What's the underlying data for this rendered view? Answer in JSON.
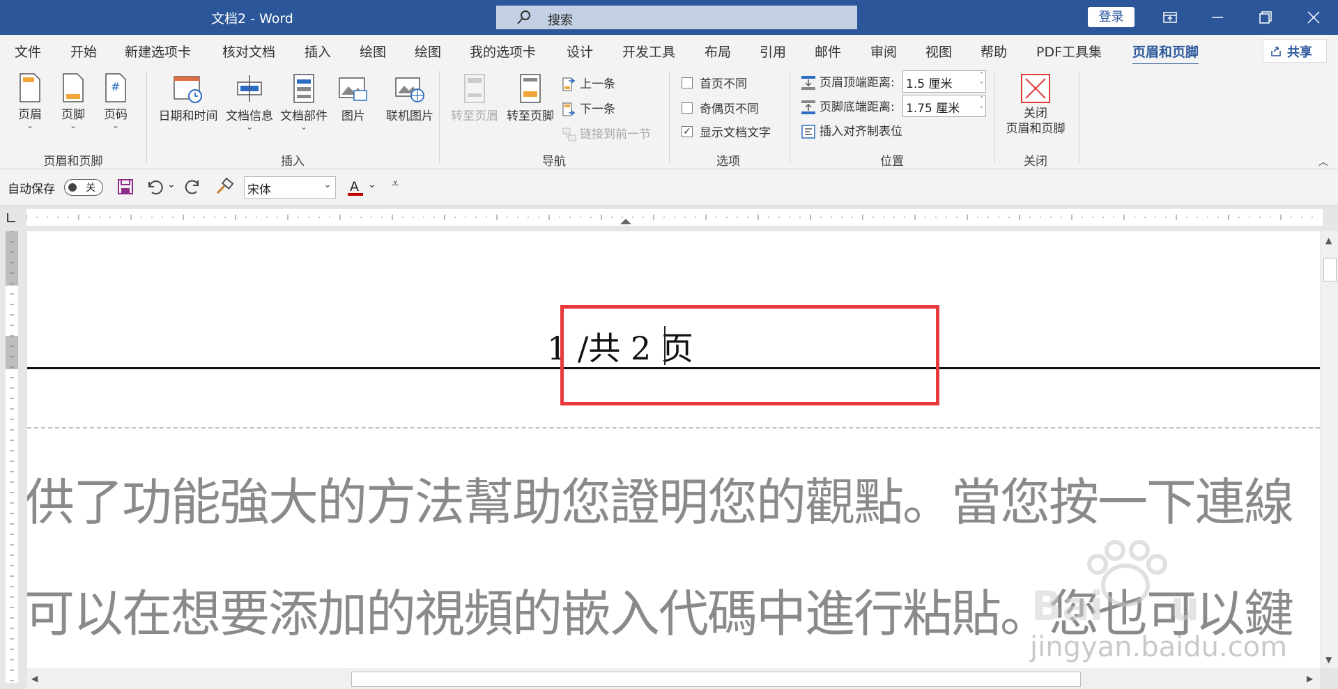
{
  "window": {
    "title": "文档2  -  Word",
    "search_placeholder": "搜索",
    "login_label": "登录"
  },
  "tabs": [
    "文件",
    "开始",
    "新建选项卡",
    "核对文档",
    "插入",
    "绘图",
    "绘图",
    "我的选项卡",
    "设计",
    "开发工具",
    "布局",
    "引用",
    "邮件",
    "审阅",
    "视图",
    "帮助",
    "PDF工具集",
    "页眉和页脚"
  ],
  "active_tab": "页眉和页脚",
  "share_label": "共享",
  "ribbon": {
    "hf_group": {
      "label": "页眉和页脚",
      "header": "页眉",
      "footer": "页脚",
      "page_number": "页码"
    },
    "insert_group": {
      "label": "插入",
      "datetime": "日期和时间",
      "docinfo": "文档信息",
      "quickparts": "文档部件",
      "picture": "图片",
      "online_picture": "联机图片"
    },
    "nav_group": {
      "label": "导航",
      "goto_header": "转至页眉",
      "goto_footer": "转至页脚",
      "previous": "上一条",
      "next": "下一条",
      "link_previous": "链接到前一节"
    },
    "options_group": {
      "label": "选项",
      "different_first": "首页不同",
      "different_odd_even": "奇偶页不同",
      "show_doc_text": "显示文档文字",
      "show_doc_text_checked": true
    },
    "position_group": {
      "label": "位置",
      "header_top": "页眉顶端距离:",
      "header_top_value": "1.5 厘米",
      "footer_bottom": "页脚底端距离:",
      "footer_bottom_value": "1.75 厘米",
      "insert_tab": "插入对齐制表位"
    },
    "close_group": {
      "label": "关闭",
      "close_line1": "关闭",
      "close_line2": "页眉和页脚"
    }
  },
  "qat": {
    "autosave_label": "自动保存",
    "autosave_state": "关",
    "font": "宋体",
    "font_color": "#c00000"
  },
  "document": {
    "header_text": "1 /共 2 页",
    "body_line_1": "供了功能強大的方法幫助您證明您的觀點。當您按一下連線",
    "body_line_2": "可以在想要添加的視頻的嵌入代碼中進行粘貼。您也可以鍵"
  },
  "watermark": {
    "text": "jingyan.baidu.com"
  },
  "colors": {
    "title_bar": "#2b579a",
    "highlight": "#e8393d"
  }
}
